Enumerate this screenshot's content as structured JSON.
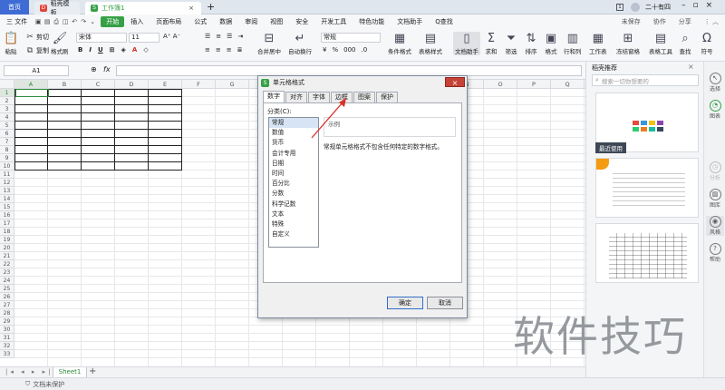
{
  "tabs": {
    "home": "首页",
    "template": "稻壳模板",
    "workbook": "工作簿1",
    "new_tab": "+",
    "user": "二十有四"
  },
  "menu": {
    "file": "三 文件",
    "start": "开始",
    "items": [
      "插入",
      "页面布局",
      "公式",
      "数据",
      "审阅",
      "视图",
      "安全",
      "开发工具",
      "特色功能",
      "文档助手"
    ],
    "search": "Q查找",
    "unsaved": "未保存",
    "collab": "协作",
    "share": "分享"
  },
  "ribbon": {
    "paste": "粘贴",
    "cut": "剪切",
    "copy": "复制",
    "format_painter": "格式刷",
    "font": "宋体",
    "size": "11",
    "merge": "合并居中",
    "wrap": "自动换行",
    "number_format": "常规",
    "cond_format": "条件格式",
    "table_style": "表格样式",
    "doc_assist": "文档助手",
    "sum": "求和",
    "filter": "筛选",
    "sort": "排序",
    "format": "格式",
    "rowcol": "行和列",
    "worksheet": "工作表",
    "freeze": "冻结窗格",
    "table_tools": "表格工具",
    "find": "查找",
    "symbol": "符号"
  },
  "formula": {
    "cell_ref": "A1",
    "fx": "fx"
  },
  "columns": [
    "A",
    "B",
    "C",
    "D",
    "E",
    "F",
    "G",
    "H",
    "I",
    "J",
    "K",
    "L",
    "M",
    "N",
    "O",
    "P",
    "Q",
    "R"
  ],
  "rows": [
    "1",
    "2",
    "3",
    "4",
    "5",
    "6",
    "7",
    "8",
    "9",
    "10",
    "11",
    "12",
    "13",
    "14",
    "15",
    "16",
    "17",
    "18",
    "19",
    "20",
    "21",
    "22",
    "23",
    "24",
    "25",
    "26",
    "27",
    "28",
    "29",
    "30",
    "31",
    "32",
    "33"
  ],
  "sheet": {
    "name": "Sheet1",
    "add": "+"
  },
  "status": {
    "protect": "文档未保护"
  },
  "dialog": {
    "title": "单元格格式",
    "close": "×",
    "tabs": [
      "数字",
      "对齐",
      "字体",
      "边框",
      "图案",
      "保护"
    ],
    "category_label": "分类(C):",
    "categories": [
      "常规",
      "数值",
      "货币",
      "会计专用",
      "日期",
      "时间",
      "百分比",
      "分数",
      "科学记数",
      "文本",
      "特殊",
      "自定义"
    ],
    "sample_label": "示例",
    "description": "常规单元格格式不包含任何特定的数字格式。",
    "ok": "确定",
    "cancel": "取消"
  },
  "panel": {
    "title": "稻壳推荐",
    "search_placeholder": "搜索一切你想要的",
    "recent": "最近使用"
  },
  "rail": {
    "items": [
      "选择",
      "图表",
      "分析",
      "图库",
      "风格",
      "帮助"
    ]
  },
  "watermark": "软件技巧",
  "colors": {
    "accent_green": "#37a046",
    "home_blue": "#3f6cd4",
    "close_red": "#c74236",
    "arrow_red": "#d9302c"
  }
}
